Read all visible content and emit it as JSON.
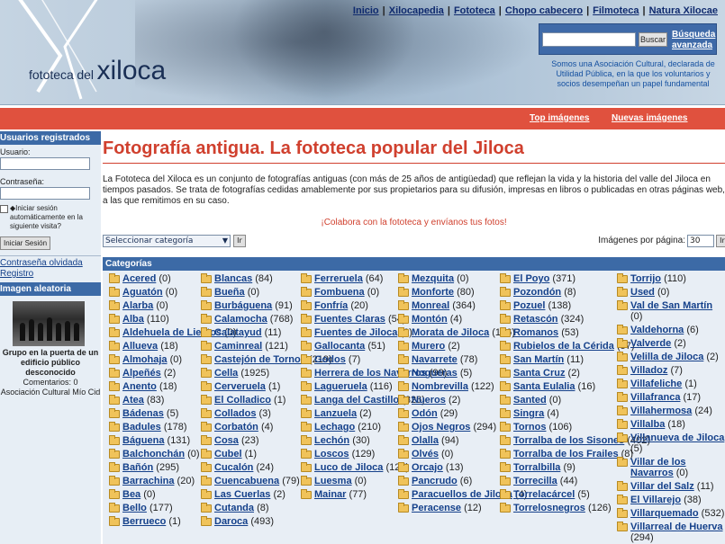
{
  "header": {
    "logo_small": "fototeca",
    "logo_del": "del",
    "logo_big": "xiloca",
    "nav": [
      "Inicio",
      "Xilocapedia",
      "Fototeca",
      "Chopo cabecero",
      "Filmoteca",
      "Natura Xilocae"
    ],
    "search_button": "Buscar",
    "advanced_search": "Búsqueda avanzada",
    "association_text": "Somos una Asociación Cultural, declarada de Utilidad Pública, en la que los voluntarios y socios desempeñan un papel fundamental"
  },
  "redbar": {
    "top_images": "Top imágenes",
    "new_images": "Nuevas imágenes"
  },
  "sidebar": {
    "registered_title": "Usuarios registrados",
    "user_label": "Usuario:",
    "password_label": "Contraseña:",
    "remember_label": "◆Iniciar sesión automáticamente en la siguiente visita?",
    "login_button": "Iniciar Sesión",
    "forgot_link": "Contraseña olvidada",
    "register_link": "Registro",
    "random_title": "Imagen aleatoria",
    "random_caption": "Grupo en la puerta de un edificio público desconocido",
    "random_comments": "Comentarios: 0",
    "random_author": "Asociación Cultural Mío Cid"
  },
  "main": {
    "title": "Fotografía antigua. La fototeca popular del Jiloca",
    "intro": "La Fototeca del Xiloca es un conjunto de fotografías antiguas (con más de 25 años de antigüedad) que reflejan la vida y la historia del valle del Jiloca en tiempos pasados. Se trata de fotografías cedidas amablemente por sus propietarios para su difusión, impresas en libros o publicadas en otras páginas web, a las que remitimos en su caso.",
    "collab": "¡Colabora con la fototeca y envíanos tus fotos!",
    "category_select": "Seleccionar categoría",
    "go_button": "Ir",
    "per_page_label": "Imágenes por página:",
    "per_page_value": "30",
    "categories_title": "Categorías"
  },
  "categories": [
    [
      [
        "Acered",
        "(0)"
      ],
      [
        "Aguatón",
        "(0)"
      ],
      [
        "Alarba",
        "(0)"
      ],
      [
        "Alba",
        "(110)"
      ],
      [
        "Aldehuela de Liestos",
        "(0)"
      ],
      [
        "Allueva",
        "(18)"
      ],
      [
        "Almohaja",
        "(0)"
      ],
      [
        "Alpeñés",
        "(2)"
      ],
      [
        "Anento",
        "(18)"
      ],
      [
        "Atea",
        "(83)"
      ],
      [
        "Bádenas",
        "(5)"
      ],
      [
        "Badules",
        "(178)"
      ],
      [
        "Báguena",
        "(131)"
      ],
      [
        "Balchonchán",
        "(0)"
      ],
      [
        "Bañón",
        "(295)"
      ],
      [
        "Barrachina",
        "(20)"
      ],
      [
        "Bea",
        "(0)"
      ],
      [
        "Bello",
        "(177)"
      ],
      [
        "Berrueco",
        "(1)"
      ]
    ],
    [
      [
        "Blancas",
        "(84)"
      ],
      [
        "Bueña",
        "(0)"
      ],
      [
        "Burbáguena",
        "(91)"
      ],
      [
        "Calamocha",
        "(768)"
      ],
      [
        "Calatayud",
        "(11)"
      ],
      [
        "Caminreal",
        "(121)"
      ],
      [
        "Castejón de Tornos",
        "(219)"
      ],
      [
        "Cella",
        "(1925)"
      ],
      [
        "Cerveruela",
        "(1)"
      ],
      [
        "El Colladico",
        "(1)"
      ],
      [
        "Collados",
        "(3)"
      ],
      [
        "Corbatón",
        "(4)"
      ],
      [
        "Cosa",
        "(23)"
      ],
      [
        "Cubel",
        "(1)"
      ],
      [
        "Cucalón",
        "(24)"
      ],
      [
        "Cuencabuena",
        "(79)"
      ],
      [
        "Las Cuerlas",
        "(2)"
      ],
      [
        "Cutanda",
        "(8)"
      ],
      [
        "Daroca",
        "(493)"
      ]
    ],
    [
      [
        "Ferreruela",
        "(64)"
      ],
      [
        "Fombuena",
        "(0)"
      ],
      [
        "Fonfría",
        "(20)"
      ],
      [
        "Fuentes Claras",
        "(54)"
      ],
      [
        "Fuentes de Jiloca",
        "(2)"
      ],
      [
        "Gallocanta",
        "(51)"
      ],
      [
        "Godos",
        "(7)"
      ],
      [
        "Herrera de los Navarros",
        "(99)"
      ],
      [
        "Lagueruela",
        "(116)"
      ],
      [
        "Langa del Castillo",
        "(326)"
      ],
      [
        "Lanzuela",
        "(2)"
      ],
      [
        "Lechago",
        "(210)"
      ],
      [
        "Lechón",
        "(30)"
      ],
      [
        "Loscos",
        "(129)"
      ],
      [
        "Luco de Jiloca",
        "(125)"
      ],
      [
        "Luesma",
        "(0)"
      ],
      [
        "Mainar",
        "(77)"
      ]
    ],
    [
      [
        "Mezquita",
        "(0)"
      ],
      [
        "Monforte",
        "(80)"
      ],
      [
        "Monreal",
        "(364)"
      ],
      [
        "Montón",
        "(4)"
      ],
      [
        "Morata de Jiloca",
        "(196)"
      ],
      [
        "Murero",
        "(2)"
      ],
      [
        "Navarrete",
        "(78)"
      ],
      [
        "Nogueras",
        "(5)"
      ],
      [
        "Nombrevilla",
        "(122)"
      ],
      [
        "Nueros",
        "(2)"
      ],
      [
        "Odón",
        "(29)"
      ],
      [
        "Ojos Negros",
        "(294)"
      ],
      [
        "Olalla",
        "(94)"
      ],
      [
        "Olvés",
        "(0)"
      ],
      [
        "Orcajo",
        "(13)"
      ],
      [
        "Pancrudo",
        "(6)"
      ],
      [
        "Paracuellos de Jiloca",
        "(4)"
      ],
      [
        "Peracense",
        "(12)"
      ]
    ],
    [
      [
        "El Poyo",
        "(371)"
      ],
      [
        "Pozondón",
        "(8)"
      ],
      [
        "Pozuel",
        "(138)"
      ],
      [
        "Retascón",
        "(324)"
      ],
      [
        "Romanos",
        "(53)"
      ],
      [
        "Rubielos de la Cérida",
        "(57)"
      ],
      [
        "San Martín",
        "(11)"
      ],
      [
        "Santa Cruz",
        "(2)"
      ],
      [
        "Santa Eulalia",
        "(16)"
      ],
      [
        "Santed",
        "(0)"
      ],
      [
        "Singra",
        "(4)"
      ],
      [
        "Tornos",
        "(106)"
      ],
      [
        "Torralba de los Sisones",
        "(402)"
      ],
      [
        "Torralba de los Frailes",
        "(8)"
      ],
      [
        "Torralbilla",
        "(9)"
      ],
      [
        "Torrecilla",
        "(44)"
      ],
      [
        "Torrelacárcel",
        "(5)"
      ],
      [
        "Torrelosnegros",
        "(126)"
      ]
    ],
    [
      [
        "Torrijo",
        "(110)"
      ],
      [
        "Used",
        "(0)"
      ],
      [
        "Val de San Martín",
        "(0)"
      ],
      [
        "Valdehorna",
        "(6)"
      ],
      [
        "Valverde",
        "(2)"
      ],
      [
        "Velilla de Jiloca",
        "(2)"
      ],
      [
        "Villadoz",
        "(7)"
      ],
      [
        "Villafeliche",
        "(1)"
      ],
      [
        "Villafranca",
        "(17)"
      ],
      [
        "Villahermosa",
        "(24)"
      ],
      [
        "Villalba",
        "(18)"
      ],
      [
        "Villanueva de Jiloca",
        "(5)"
      ],
      [
        "Villar de los Navarros",
        "(0)"
      ],
      [
        "Villar del Salz",
        "(11)"
      ],
      [
        "El Villarejo",
        "(38)"
      ],
      [
        "Villarquemado",
        "(532)"
      ],
      [
        "Villarreal de Huerva",
        "(294)"
      ]
    ]
  ]
}
